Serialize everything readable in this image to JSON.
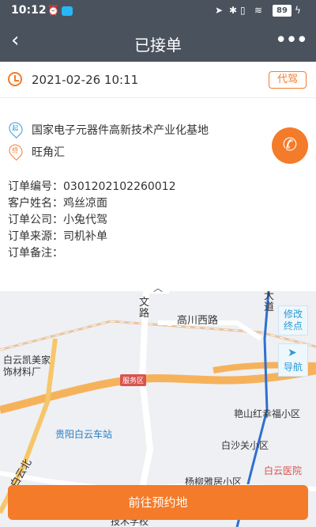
{
  "status_bar": {
    "time": "10:12",
    "battery": "89"
  },
  "header": {
    "back": "‹",
    "title": "已接单",
    "more": "•••"
  },
  "order": {
    "datetime": "2021-02-26 10:11",
    "tag": "代驾",
    "from_marker": "起",
    "from": "国家电子元器件高新技术产业化基地",
    "to_marker": "终",
    "to": "旺角汇",
    "info": [
      "订单编号：0301202102260012",
      "客户姓名：鸡丝凉面",
      "订单公司：小兔代驾",
      "订单来源：司机补单",
      "订单备注："
    ]
  },
  "map": {
    "labels": {
      "wen_road": "文\n路",
      "gaochuan": "高川西路",
      "kaimei": "白云凯美家\n饰材料厂",
      "service": "服务区",
      "station": "贵阳白云车站",
      "yanshan": "艳山红幸福小区",
      "baisha": "白沙关小区",
      "hospital": "白云医院",
      "yangliu": "杨柳雅居小区",
      "school": "技术学校",
      "baiyun_north": "白云北",
      "road_tag": "大\n道"
    },
    "btn_modify": "修改\n终点",
    "btn_nav": "导航"
  },
  "action": {
    "label": "前往预约地"
  },
  "colors": {
    "accent": "#f47b2a",
    "header": "#4a525e",
    "map_blue": "#2a9bd6"
  }
}
